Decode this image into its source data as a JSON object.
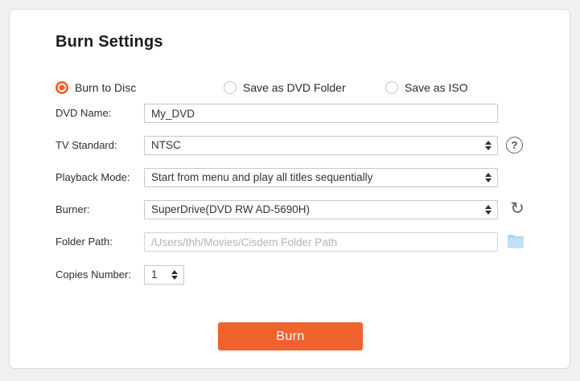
{
  "colors": {
    "accent": "#F2622E",
    "folder_icon": "#A9D4EF"
  },
  "panel": {
    "title": "Burn Settings"
  },
  "radios": [
    {
      "label": "Burn to Disc",
      "selected": true
    },
    {
      "label": "Save as DVD Folder",
      "selected": false
    },
    {
      "label": "Save as ISO",
      "selected": false
    }
  ],
  "fields": {
    "dvd_name": {
      "label": "DVD Name:",
      "value": "My_DVD"
    },
    "tv_standard": {
      "label": "TV Standard:",
      "value": "NTSC"
    },
    "playback_mode": {
      "label": "Playback Mode:",
      "value": "Start from menu and play all titles sequentially"
    },
    "burner": {
      "label": "Burner:",
      "value": "SuperDrive(DVD RW AD-5690H)"
    },
    "folder_path": {
      "label": "Folder Path:",
      "placeholder": "/Users/thh/Movies/Cisdem Folder Path"
    },
    "copies_number": {
      "label": "Copies Number:",
      "value": "1"
    }
  },
  "icons": {
    "help_glyph": "?",
    "refresh_glyph": "↻"
  },
  "actions": {
    "burn_label": "Burn"
  }
}
